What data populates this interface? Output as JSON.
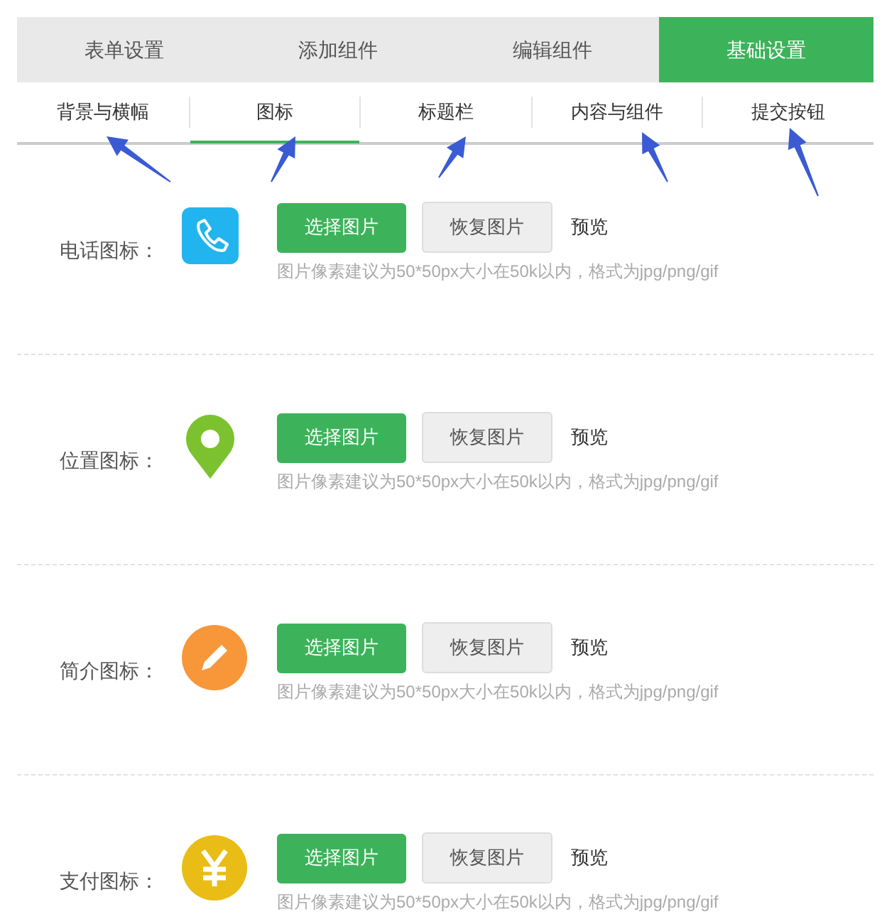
{
  "tabs": [
    {
      "label": "表单设置",
      "selected": false
    },
    {
      "label": "添加组件",
      "selected": false
    },
    {
      "label": "编辑组件",
      "selected": false
    },
    {
      "label": "基础设置",
      "selected": true
    }
  ],
  "subtabs": [
    {
      "label": "背景与横幅",
      "selected": false
    },
    {
      "label": "图标",
      "selected": true
    },
    {
      "label": "标题栏",
      "selected": false
    },
    {
      "label": "内容与组件",
      "selected": false
    },
    {
      "label": "提交按钮",
      "selected": false
    }
  ],
  "icon_settings": [
    {
      "label": "电话图标：",
      "kind": "phone",
      "color": "#22b4ee",
      "choose_button": "选择图片",
      "restore_button": "恢复图片",
      "preview": "预览",
      "hint": "图片像素建议为50*50px大小在50k以内，格式为jpg/png/gif"
    },
    {
      "label": "位置图标：",
      "kind": "location",
      "color": "#7cc22e",
      "choose_button": "选择图片",
      "restore_button": "恢复图片",
      "preview": "预览",
      "hint": "图片像素建议为50*50px大小在50k以内，格式为jpg/png/gif"
    },
    {
      "label": "简介图标：",
      "kind": "pencil",
      "color": "#f7973a",
      "choose_button": "选择图片",
      "restore_button": "恢复图片",
      "preview": "预览",
      "hint": "图片像素建议为50*50px大小在50k以内，格式为jpg/png/gif"
    },
    {
      "label": "支付图标：",
      "kind": "yen",
      "color": "#e9bd16",
      "choose_button": "选择图片",
      "restore_button": "恢复图片",
      "preview": "预览",
      "hint": "图片像素建议为50*50px大小在50k以内，格式为jpg/png/gif"
    }
  ]
}
